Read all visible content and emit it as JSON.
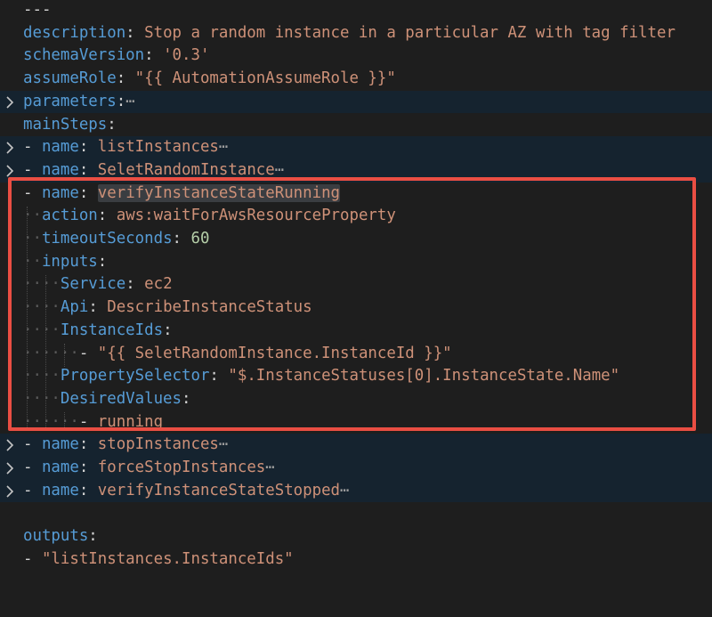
{
  "editor": {
    "doc_start": "---",
    "description_key": "description",
    "description_value": "Stop a random instance in a particular AZ with tag filter",
    "schema_key": "schemaVersion",
    "schema_value": "'0.3'",
    "assume_key": "assumeRole",
    "assume_value": "\"{{ AutomationAssumeRole }}\"",
    "parameters_key": "parameters",
    "mainsteps_key": "mainSteps",
    "name_key": "name",
    "step1_name": "listInstances",
    "step2_name": "SeletRandomInstance",
    "step3_name": "verifyInstanceStateRunning",
    "action_key": "action",
    "action_value": "aws:waitForAwsResourceProperty",
    "timeout_key": "timeoutSeconds",
    "timeout_value": "60",
    "inputs_key": "inputs",
    "service_key": "Service",
    "service_value": "ec2",
    "api_key": "Api",
    "api_value": "DescribeInstanceStatus",
    "instanceids_key": "InstanceIds",
    "instanceids_item": "\"{{ SeletRandomInstance.InstanceId }}\"",
    "selector_key": "PropertySelector",
    "selector_value": "\"$.InstanceStatuses[0].InstanceState.Name\"",
    "desired_key": "DesiredValues",
    "desired_item": "running",
    "step4_name": "stopInstances",
    "step5_name": "forceStopInstances",
    "step6_name": "verifyInstanceStateStopped",
    "outputs_key": "outputs",
    "outputs_item": "\"listInstances.InstanceIds\"",
    "fold_ellipsis": "⋯"
  },
  "colors": {
    "background": "#1e1e1e",
    "folded_line": "#15232f",
    "key": "#569cd6",
    "string": "#ce9178",
    "number": "#b5cea8",
    "highlight_box": "#ea4e43"
  },
  "icons": {
    "fold": "chevron-right-icon"
  }
}
